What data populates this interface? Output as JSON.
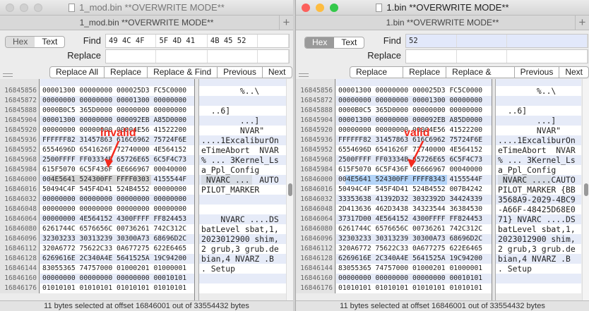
{
  "colors": {
    "accent_red": "#f42a1e",
    "selection_blue": "#b3d4f8",
    "selection_grey": "#d6d6d6"
  },
  "left": {
    "window_title": "1_mod.bin **OVERWRITE MODE**",
    "tab_title": "1_mod.bin **OVERWRITE MODE**",
    "mode_hex": "Hex",
    "mode_text": "Text",
    "find_label": "Find",
    "find_value": [
      "49 4C 4F 54",
      "5F 4D 41 52",
      "4B 45 52",
      ""
    ],
    "replace_label": "Replace",
    "buttons": [
      "Replace All",
      "Replace",
      "Replace & Find",
      "Previous",
      "Next"
    ],
    "annotation": "invalid",
    "status": "11 bytes selected at offset 16846001 out of 33554432 bytes",
    "rows": [
      [
        "16845856",
        "00001300 00000000 000025D3 FC5C0000",
        "        %..\\"
      ],
      [
        "16845872",
        "00000000 00000000 00001300 00000000",
        ""
      ],
      [
        "16845888",
        "0000B0C5 365D0000 00000000 00000000",
        "  ..6]"
      ],
      [
        "16845904",
        "00001300 00000000 000092EB A85D0000",
        "        ...]"
      ],
      [
        "16845920",
        "00000000 00000000 00004E56 41522200",
        "        NVAR\""
      ],
      [
        "16845936",
        "FFFFFF82 31457863 616C6962 75724F6E",
        "....1ExcaliburOn"
      ],
      [
        "16845952",
        "6554696D 6541626F 72740000 4E564152",
        "eTimeAbort  NVAR"
      ],
      [
        "16845968",
        "2500FFFF FF03334B 65726E65 6C5F4C73",
        "% ... 3Kernel_Ls"
      ],
      [
        "16845984",
        "615F5070 6C5F436F 6E666967 00040000",
        "a_Ppl_Config"
      ],
      [
        "16846000",
        "004E5641 524300FF FFFF0303 4155544F",
        " NVARC ...  AUTO"
      ],
      [
        "16846016",
        "50494C4F 545F4D41 524B4552 00000000",
        "PILOT_MARKER"
      ],
      [
        "16846032",
        "00000000 00000000 00000000 00000000",
        ""
      ],
      [
        "16846048",
        "00000000 00000000 00000000 00000000",
        ""
      ],
      [
        "16846064",
        "00000000 4E564152 4300FFFF FF824453",
        "    NVARC ....DS"
      ],
      [
        "16846080",
        "6261744C 6576656C 00736261 742C312C",
        "batLevel sbat,1,"
      ],
      [
        "16846096",
        "32303233 30313239 30300A73 68696D2C",
        "2023012900 shim,"
      ],
      [
        "16846112",
        "320A6772 75622C33 0A677275 622E6465",
        "2 grub,3 grub.de"
      ],
      [
        "16846128",
        "6269616E 2C340A4E 5641525A 19C94200",
        "bian,4 NVARZ .B"
      ],
      [
        "16846144",
        "83055365 74757000 01000201 01000001",
        ". Setup"
      ],
      [
        "16846160",
        "00000000 00000000 00000000 00010101",
        ""
      ],
      [
        "16846176",
        "01010101 01010101 01010101 01010101",
        ""
      ]
    ]
  },
  "right": {
    "window_title": "1.bin **OVERWRITE MODE**",
    "tab_title": "1.bin **OVERWRITE MODE**",
    "mode_hex": "Hex",
    "mode_text": "Text",
    "find_label": "Find",
    "find_value": [
      "52",
      "",
      ""
    ],
    "replace_label": "Replace",
    "buttons": [
      "Replace All",
      "Replace",
      "Replace & Find",
      "Previous",
      "Next"
    ],
    "annotation": "valid",
    "status": "11 bytes selected at offset 16846001 out of 33554432 bytes",
    "rows": [
      [
        "16845856",
        "00001300 00000000 000025D3 FC5C0000",
        "        %..\\"
      ],
      [
        "16845872",
        "00000000 00000000 00001300 00000000",
        ""
      ],
      [
        "16845888",
        "0000B0C5 365D0000 00000000 00000000",
        "  ..6]"
      ],
      [
        "16845904",
        "00001300 00000000 000092EB A85D0000",
        "        ...]"
      ],
      [
        "16845920",
        "00000000 00000000 00004E56 41522200",
        "        NVAR\""
      ],
      [
        "16845936",
        "FFFFFF82 31457863 616C6962 75724F6E",
        "....1ExcaliburOn"
      ],
      [
        "16845952",
        "6554696D 6541626F 72740000 4E564152",
        "eTimeAbort  NVAR"
      ],
      [
        "16845968",
        "2500FFFF FF03334B 65726E65 6C5F4C73",
        "% ... 3Kernel_Ls"
      ],
      [
        "16845984",
        "615F5070 6C5F436F 6E666967 00040000",
        "a_Ppl_Config"
      ],
      [
        "16846000",
        "004E5641 524300FF FFFF8343 4155544F",
        " NVARC ....CAUTO"
      ],
      [
        "16846016",
        "50494C4F 545F4D41 524B4552 007B4242",
        "PILOT_MARKER {BB"
      ],
      [
        "16846032",
        "33353638 41392D32 3032392D 34424339",
        "3568A9-2029-4BC9"
      ],
      [
        "16846048",
        "2D413636 462D3438 34323544 36384530",
        "-A66F-48425D68E0"
      ],
      [
        "16846064",
        "37317D00 4E564152 4300FFFF FF824453",
        "71} NVARC ....DS"
      ],
      [
        "16846080",
        "6261744C 6576656C 00736261 742C312C",
        "batLevel sbat,1,"
      ],
      [
        "16846096",
        "32303233 30313239 30300A73 68696D2C",
        "2023012900 shim,"
      ],
      [
        "16846112",
        "320A6772 75622C33 0A677275 622E6465",
        "2 grub,3 grub.de"
      ],
      [
        "16846128",
        "6269616E 2C340A4E 5641525A 19C94200",
        "bian,4 NVARZ .B"
      ],
      [
        "16846144",
        "83055365 74757000 01000201 01000001",
        ". Setup"
      ],
      [
        "16846160",
        "00000000 00000000 00000000 00010101",
        ""
      ],
      [
        "16846176",
        "01010101 01010101 01010101 01010101",
        ""
      ]
    ]
  }
}
